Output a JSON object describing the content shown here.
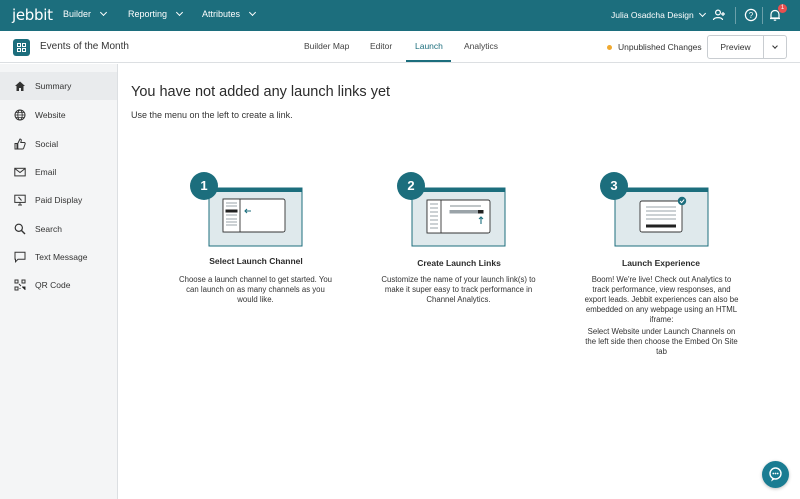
{
  "topnav": {
    "logo": "jebbit",
    "menus": [
      "Builder",
      "Reporting",
      "Attributes"
    ],
    "account": "Julia Osadcha Design",
    "notification_count": "1"
  },
  "header": {
    "title": "Events of the Month",
    "tabs": [
      "Builder Map",
      "Editor",
      "Launch",
      "Analytics"
    ],
    "active_tab": "Launch",
    "status": "Unpublished Changes",
    "preview_label": "Preview"
  },
  "sidebar": {
    "items": [
      {
        "label": "Summary",
        "icon": "home-icon",
        "active": true
      },
      {
        "label": "Website",
        "icon": "globe-icon"
      },
      {
        "label": "Social",
        "icon": "thumbs-up-icon"
      },
      {
        "label": "Email",
        "icon": "envelope-icon"
      },
      {
        "label": "Paid Display",
        "icon": "monitor-icon"
      },
      {
        "label": "Search",
        "icon": "search-icon"
      },
      {
        "label": "Text Message",
        "icon": "chat-bubble-icon"
      },
      {
        "label": "QR Code",
        "icon": "qr-code-icon"
      }
    ]
  },
  "main": {
    "heading": "You have not added any launch links yet",
    "subtext": "Use the menu on the left to create a link.",
    "steps": [
      {
        "number": "1",
        "title": "Select Launch Channel",
        "desc": "Choose a launch channel to get started. You can launch on as many channels as you would like."
      },
      {
        "number": "2",
        "title": "Create Launch Links",
        "desc": "Customize the name of your launch link(s) to make it super easy to track performance in Channel Analytics."
      },
      {
        "number": "3",
        "title": "Launch Experience",
        "desc": "Boom! We're live! Check out Analytics to track performance, view responses, and export leads. Jebbit experiences can also be embedded on any webpage using an HTML iframe:",
        "desc2": "Select Website under Launch Channels on the left side then choose the Embed On Site tab"
      }
    ]
  },
  "colors": {
    "brand": "#1c6e7d",
    "status_dot": "#f0a92f",
    "badge": "#e84f4f"
  }
}
